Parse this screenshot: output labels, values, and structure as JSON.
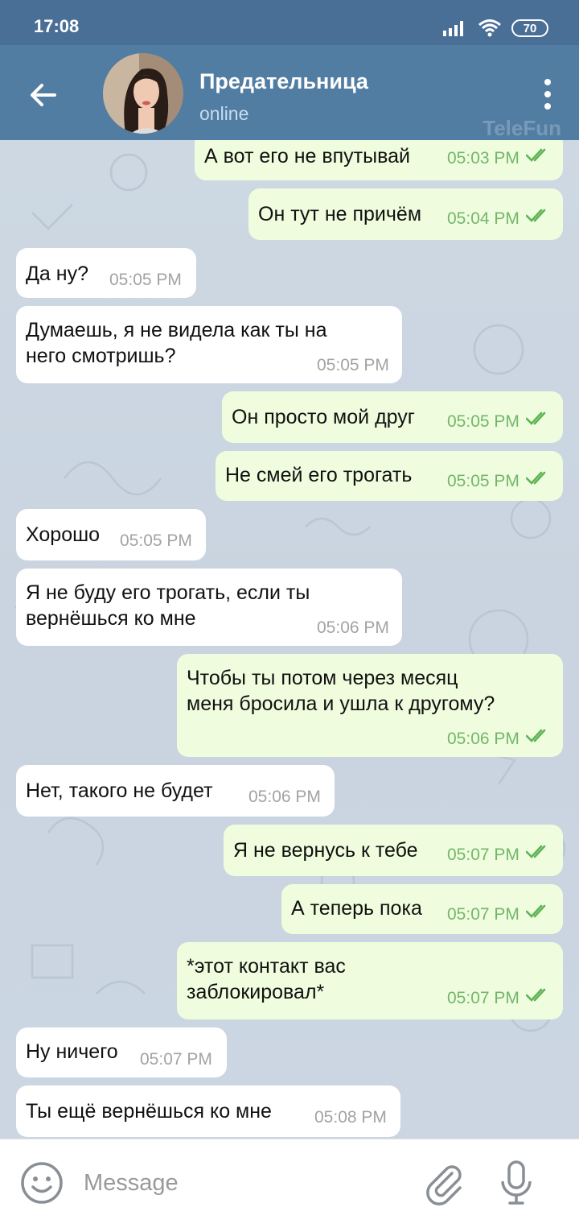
{
  "status_bar": {
    "time": "17:08",
    "battery": "70",
    "icons": [
      "signal-icon",
      "wifi-icon",
      "battery-icon"
    ]
  },
  "header": {
    "name": "Предательница",
    "status": "online",
    "watermark": "TeleFun",
    "icons": [
      "back-arrow-icon",
      "avatar",
      "more-vert-icon"
    ]
  },
  "messages": [
    {
      "dir": "out",
      "text": "А вот его не впутывай",
      "time": "05:03 PM"
    },
    {
      "dir": "out",
      "text": "Он тут не причём",
      "time": "05:04 PM"
    },
    {
      "dir": "in",
      "text": "Да ну?",
      "time": "05:05 PM"
    },
    {
      "dir": "in",
      "text": "Думаешь, я не видела как ты на\nнего смотришь?",
      "time": "05:05 PM"
    },
    {
      "dir": "out",
      "text": "Он просто мой друг",
      "time": "05:05 PM"
    },
    {
      "dir": "out",
      "text": "Не смей его трогать",
      "time": "05:05 PM"
    },
    {
      "dir": "in",
      "text": "Хорошо",
      "time": "05:05 PM"
    },
    {
      "dir": "in",
      "text": "Я не буду его трогать, если ты\nвернёшься ко мне",
      "time": "05:06 PM"
    },
    {
      "dir": "out",
      "text": "Чтобы ты потом через месяц\nменя бросила и ушла к другому?",
      "time": "05:06 PM"
    },
    {
      "dir": "in",
      "text": "Нет, такого не будет",
      "time": "05:06 PM"
    },
    {
      "dir": "out",
      "text": "Я не вернусь к тебе",
      "time": "05:07 PM"
    },
    {
      "dir": "out",
      "text": "А теперь пока",
      "time": "05:07 PM"
    },
    {
      "dir": "out",
      "text": "*этот контакт вас\nзаблокировал*",
      "time": "05:07 PM"
    },
    {
      "dir": "in",
      "text": "Ну ничего",
      "time": "05:07 PM"
    },
    {
      "dir": "in",
      "text": "Ты ещё вернёшься ко мне",
      "time": "05:08 PM"
    }
  ],
  "composer": {
    "placeholder": "Message",
    "icons": [
      "emoji-icon",
      "attach-icon",
      "mic-icon"
    ]
  },
  "colors": {
    "header": "#527da3",
    "status_bar": "#4a6f96",
    "outgoing_bubble": "#effdde",
    "incoming_bubble": "#ffffff",
    "check": "#5fb455"
  }
}
